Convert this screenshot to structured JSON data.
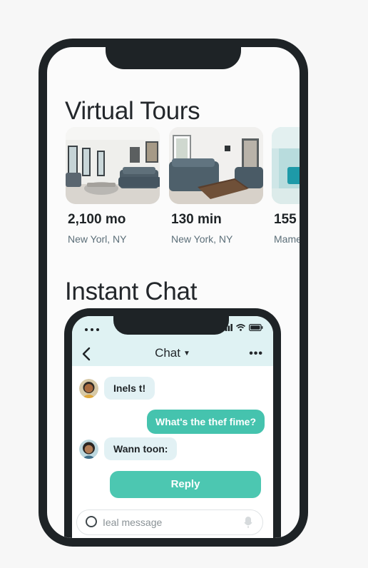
{
  "tours": {
    "title": "Virtual Tours",
    "cards": [
      {
        "price": "2,100 mo",
        "location": "New Yorl, NY"
      },
      {
        "price": "130 min",
        "location": "New York, NY"
      },
      {
        "price": "155",
        "location": "Mame"
      }
    ]
  },
  "chat": {
    "section_title": "Instant Chat",
    "header_title": "Chat",
    "messages": [
      {
        "direction": "in",
        "text": "Inels t!"
      },
      {
        "direction": "out",
        "text": "What's the thef fime?"
      },
      {
        "direction": "in",
        "text": "Wann toon:"
      }
    ],
    "reply_label": "Reply",
    "input_placeholder": "Ieal message"
  },
  "colors": {
    "accent": "#45c3ae",
    "header_bg": "#dff2f3",
    "bubble_in": "#e2f1f4",
    "frame": "#1e2326"
  },
  "icons": [
    "back-arrow-icon",
    "caret-down-icon",
    "more-icon",
    "signal-icon",
    "wifi-icon",
    "battery-icon",
    "circle-icon",
    "mic-icon"
  ]
}
